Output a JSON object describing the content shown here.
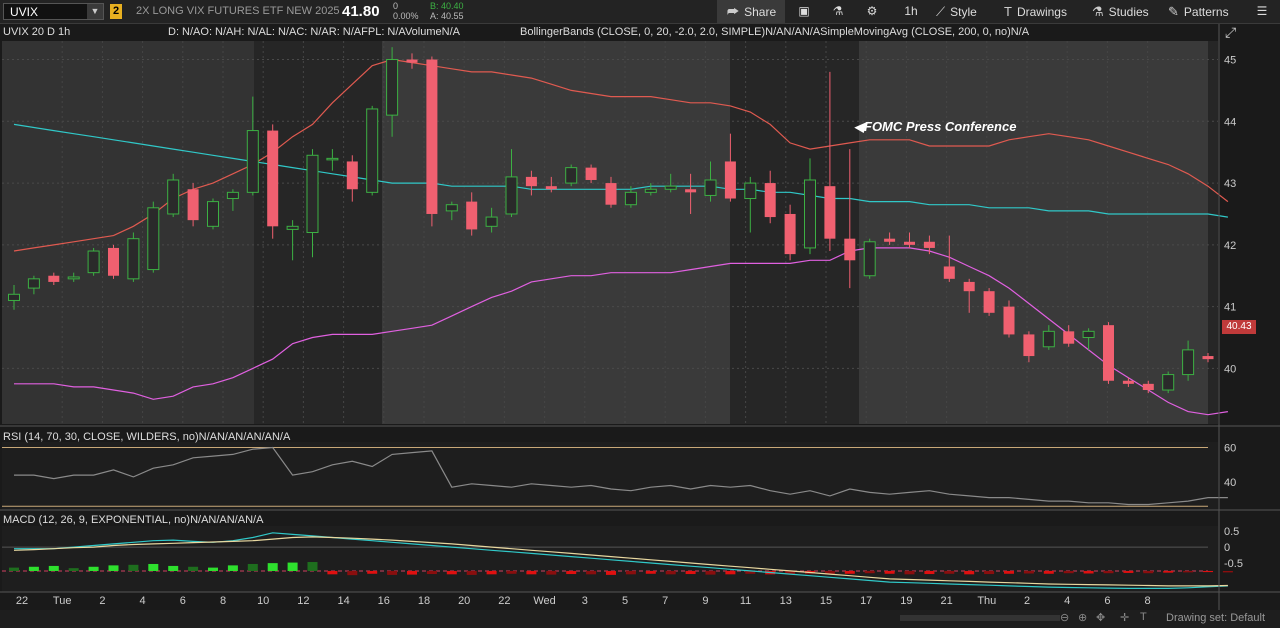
{
  "header": {
    "symbol": "UVIX",
    "badge": "2",
    "description": "2X LONG VIX FUTURES ETF NEW 2025",
    "last_price": "41.80",
    "change": "0",
    "change_pct": "0.00%",
    "bid": "B: 40.40",
    "ask": "A: 40.55"
  },
  "toolbar": {
    "share": "Share",
    "interval": "1h",
    "style": "Style",
    "drawings": "Drawings",
    "studies": "Studies",
    "patterns": "Patterns"
  },
  "legend": {
    "main_title": "UVIX 20 D 1h",
    "main_stats": "D: N/AO: N/AH: N/AL: N/AC: N/AR: N/AFPL: N/AVolumeN/A",
    "studies": "BollingerBands (CLOSE, 0, 20, -2.0, 2.0, SIMPLE)N/AN/AN/ASimpleMovingAvg (CLOSE, 200, 0, no)N/A",
    "rsi": "RSI (14, 70, 30, CLOSE, WILDERS, no)N/AN/AN/AN/AN/A",
    "macd": "MACD (12, 26, 9, EXPONENTIAL, no)N/AN/AN/AN/A"
  },
  "annotation": "FOMC Press Conference",
  "current_price_tag": "40.43",
  "price_axis": [
    "45",
    "44",
    "43",
    "42",
    "41",
    "40"
  ],
  "rsi_axis": [
    "60",
    "40"
  ],
  "macd_axis": [
    "0.5",
    "0",
    "-0.5"
  ],
  "time_axis": [
    "22",
    "Tue",
    "2",
    "4",
    "6",
    "8",
    "10",
    "12",
    "14",
    "16",
    "18",
    "20",
    "22",
    "Wed",
    "3",
    "5",
    "7",
    "9",
    "11",
    "13",
    "15",
    "17",
    "19",
    "21",
    "Thu",
    "2",
    "4",
    "6",
    "8"
  ],
  "bottom": {
    "drawing_set": "Drawing set: Default"
  },
  "colors": {
    "up": "#3cb043",
    "down": "#f06070",
    "upper_band": "#e05a50",
    "lower_band": "#e060e0",
    "sma": "#30c8c8",
    "macd_line": "#30c8c8",
    "signal": "#e8d8a0"
  },
  "chart_data": {
    "type": "candlestick",
    "interval": "1h",
    "y_range": [
      39.1,
      45.3
    ],
    "candles": [
      {
        "o": 41.1,
        "h": 41.35,
        "l": 40.95,
        "c": 41.2
      },
      {
        "o": 41.3,
        "h": 41.5,
        "l": 41.2,
        "c": 41.45
      },
      {
        "o": 41.5,
        "h": 41.55,
        "l": 41.35,
        "c": 41.4
      },
      {
        "o": 41.45,
        "h": 41.55,
        "l": 41.4,
        "c": 41.48
      },
      {
        "o": 41.55,
        "h": 41.95,
        "l": 41.5,
        "c": 41.9
      },
      {
        "o": 41.95,
        "h": 42.0,
        "l": 41.45,
        "c": 41.5
      },
      {
        "o": 41.45,
        "h": 42.2,
        "l": 41.4,
        "c": 42.1
      },
      {
        "o": 41.6,
        "h": 42.7,
        "l": 41.55,
        "c": 42.6
      },
      {
        "o": 42.5,
        "h": 43.15,
        "l": 42.45,
        "c": 43.05
      },
      {
        "o": 42.9,
        "h": 43.0,
        "l": 42.3,
        "c": 42.4
      },
      {
        "o": 42.3,
        "h": 42.75,
        "l": 42.25,
        "c": 42.7
      },
      {
        "o": 42.75,
        "h": 42.9,
        "l": 42.55,
        "c": 42.85
      },
      {
        "o": 42.85,
        "h": 44.4,
        "l": 42.8,
        "c": 43.85
      },
      {
        "o": 43.85,
        "h": 43.95,
        "l": 42.1,
        "c": 42.3
      },
      {
        "o": 42.25,
        "h": 42.4,
        "l": 41.75,
        "c": 42.3
      },
      {
        "o": 42.2,
        "h": 43.55,
        "l": 41.8,
        "c": 43.45
      },
      {
        "o": 43.4,
        "h": 43.55,
        "l": 43.2,
        "c": 43.4
      },
      {
        "o": 43.35,
        "h": 43.45,
        "l": 42.7,
        "c": 42.9
      },
      {
        "o": 42.85,
        "h": 44.25,
        "l": 42.8,
        "c": 44.2
      },
      {
        "o": 44.1,
        "h": 45.2,
        "l": 43.75,
        "c": 45.0
      },
      {
        "o": 45.0,
        "h": 45.1,
        "l": 44.85,
        "c": 44.95
      },
      {
        "o": 45.0,
        "h": 45.05,
        "l": 42.3,
        "c": 42.5
      },
      {
        "o": 42.55,
        "h": 42.7,
        "l": 42.4,
        "c": 42.65
      },
      {
        "o": 42.7,
        "h": 42.85,
        "l": 42.15,
        "c": 42.25
      },
      {
        "o": 42.3,
        "h": 42.6,
        "l": 42.2,
        "c": 42.45
      },
      {
        "o": 42.5,
        "h": 43.55,
        "l": 42.45,
        "c": 43.1
      },
      {
        "o": 43.1,
        "h": 43.2,
        "l": 42.8,
        "c": 42.95
      },
      {
        "o": 42.95,
        "h": 43.1,
        "l": 42.85,
        "c": 42.9
      },
      {
        "o": 43.0,
        "h": 43.3,
        "l": 42.95,
        "c": 43.25
      },
      {
        "o": 43.25,
        "h": 43.3,
        "l": 43.0,
        "c": 43.05
      },
      {
        "o": 43.0,
        "h": 43.1,
        "l": 42.6,
        "c": 42.65
      },
      {
        "o": 42.65,
        "h": 42.95,
        "l": 42.6,
        "c": 42.85
      },
      {
        "o": 42.85,
        "h": 43.0,
        "l": 42.8,
        "c": 42.9
      },
      {
        "o": 42.9,
        "h": 43.15,
        "l": 42.85,
        "c": 42.95
      },
      {
        "o": 42.9,
        "h": 43.15,
        "l": 42.5,
        "c": 42.85
      },
      {
        "o": 42.8,
        "h": 43.35,
        "l": 42.7,
        "c": 43.05
      },
      {
        "o": 43.35,
        "h": 43.8,
        "l": 42.7,
        "c": 42.75
      },
      {
        "o": 42.75,
        "h": 43.1,
        "l": 42.2,
        "c": 43.0
      },
      {
        "o": 43.0,
        "h": 43.2,
        "l": 42.35,
        "c": 42.45
      },
      {
        "o": 42.5,
        "h": 42.65,
        "l": 41.75,
        "c": 41.85
      },
      {
        "o": 41.95,
        "h": 43.4,
        "l": 41.85,
        "c": 43.05
      },
      {
        "o": 42.95,
        "h": 44.8,
        "l": 41.9,
        "c": 42.1
      },
      {
        "o": 42.1,
        "h": 43.55,
        "l": 41.3,
        "c": 41.75
      },
      {
        "o": 41.5,
        "h": 42.1,
        "l": 41.45,
        "c": 42.05
      },
      {
        "o": 42.1,
        "h": 42.2,
        "l": 42.0,
        "c": 42.05
      },
      {
        "o": 42.05,
        "h": 42.2,
        "l": 41.95,
        "c": 42.0
      },
      {
        "o": 42.05,
        "h": 42.15,
        "l": 41.85,
        "c": 41.95
      },
      {
        "o": 41.65,
        "h": 42.15,
        "l": 41.4,
        "c": 41.45
      },
      {
        "o": 41.4,
        "h": 41.45,
        "l": 40.9,
        "c": 41.25
      },
      {
        "o": 41.25,
        "h": 41.3,
        "l": 40.85,
        "c": 40.9
      },
      {
        "o": 41.0,
        "h": 41.1,
        "l": 40.5,
        "c": 40.55
      },
      {
        "o": 40.55,
        "h": 40.6,
        "l": 40.1,
        "c": 40.2
      },
      {
        "o": 40.35,
        "h": 40.7,
        "l": 40.3,
        "c": 40.6
      },
      {
        "o": 40.6,
        "h": 40.7,
        "l": 40.35,
        "c": 40.4
      },
      {
        "o": 40.5,
        "h": 40.65,
        "l": 40.3,
        "c": 40.6
      },
      {
        "o": 40.7,
        "h": 40.75,
        "l": 39.75,
        "c": 39.8
      },
      {
        "o": 39.8,
        "h": 39.85,
        "l": 39.7,
        "c": 39.75
      },
      {
        "o": 39.75,
        "h": 39.8,
        "l": 39.6,
        "c": 39.65
      },
      {
        "o": 39.65,
        "h": 39.95,
        "l": 39.6,
        "c": 39.9
      },
      {
        "o": 39.9,
        "h": 40.45,
        "l": 39.8,
        "c": 40.3
      },
      {
        "o": 40.2,
        "h": 40.25,
        "l": 40.1,
        "c": 40.15
      }
    ],
    "upper_band": [
      41.9,
      41.95,
      42.0,
      42.05,
      42.1,
      42.15,
      42.3,
      42.5,
      42.75,
      42.9,
      43.0,
      43.15,
      43.3,
      43.5,
      43.75,
      43.95,
      44.3,
      44.6,
      44.9,
      45.0,
      44.95,
      44.9,
      44.85,
      44.8,
      44.8,
      44.75,
      44.7,
      44.6,
      44.5,
      44.45,
      44.4,
      44.4,
      44.4,
      44.35,
      44.3,
      44.3,
      44.25,
      44.15,
      43.95,
      43.65,
      43.55,
      43.6,
      43.65,
      43.7,
      43.7,
      43.7,
      43.6,
      43.6,
      43.6,
      43.6,
      43.7,
      43.75,
      43.8,
      43.75,
      43.7,
      43.6,
      43.5,
      43.4,
      43.3,
      43.15,
      42.95,
      42.7
    ],
    "lower_band": [
      39.75,
      39.75,
      39.75,
      39.7,
      39.7,
      39.65,
      39.6,
      39.5,
      39.55,
      39.7,
      39.75,
      39.85,
      40.0,
      40.15,
      40.4,
      40.5,
      40.55,
      40.55,
      40.55,
      40.6,
      40.65,
      40.7,
      40.85,
      41.0,
      41.15,
      41.25,
      41.4,
      41.45,
      41.5,
      41.5,
      41.55,
      41.55,
      41.55,
      41.55,
      41.6,
      41.65,
      41.7,
      41.7,
      41.7,
      41.7,
      41.75,
      41.75,
      41.9,
      41.95,
      41.95,
      41.95,
      41.9,
      41.8,
      41.65,
      41.5,
      41.3,
      41.05,
      40.8,
      40.55,
      40.3,
      40.05,
      39.85,
      39.65,
      39.45,
      39.3,
      39.25,
      39.3
    ],
    "sma": [
      43.95,
      43.9,
      43.85,
      43.8,
      43.75,
      43.7,
      43.65,
      43.6,
      43.55,
      43.5,
      43.45,
      43.4,
      43.35,
      43.3,
      43.25,
      43.2,
      43.15,
      43.1,
      43.05,
      43.0,
      43.0,
      43.0,
      42.95,
      42.95,
      42.95,
      42.95,
      42.9,
      42.9,
      42.9,
      42.9,
      42.9,
      42.9,
      42.95,
      42.95,
      42.95,
      42.95,
      42.9,
      42.9,
      42.85,
      42.85,
      42.8,
      42.75,
      42.75,
      42.7,
      42.7,
      42.7,
      42.65,
      42.65,
      42.65,
      42.6,
      42.6,
      42.6,
      42.55,
      42.55,
      42.55,
      42.5,
      42.5,
      42.5,
      42.5,
      42.5,
      42.5,
      42.45
    ],
    "rsi": [
      44,
      44,
      42,
      44,
      44,
      47,
      43,
      48,
      50,
      54,
      55,
      56,
      59,
      60,
      44,
      46,
      50,
      52,
      49,
      56,
      57,
      58,
      37,
      39,
      38,
      37,
      39,
      38,
      37,
      38,
      36,
      35,
      37,
      38,
      36,
      38,
      37,
      38,
      35,
      33,
      35,
      32,
      36,
      34,
      33,
      34,
      35,
      33,
      32,
      31,
      31,
      30,
      29,
      29,
      28,
      28,
      27,
      27,
      28,
      29,
      31,
      31
    ],
    "macd_hist": [
      0.12,
      0.15,
      0.18,
      0.1,
      0.15,
      0.2,
      0.22,
      0.25,
      0.18,
      0.15,
      0.12,
      0.2,
      0.25,
      0.28,
      0.3,
      0.32,
      -0.12,
      -0.15,
      -0.1,
      -0.14,
      -0.13,
      -0.11,
      -0.12,
      -0.14,
      -0.12,
      -0.1,
      -0.12,
      -0.13,
      -0.11,
      -0.12,
      -0.14,
      -0.12,
      -0.1,
      -0.12,
      -0.11,
      -0.13,
      -0.12,
      -0.1,
      -0.12,
      -0.11,
      -0.09,
      -0.12,
      -0.1,
      -0.08,
      -0.1,
      -0.12,
      -0.11,
      -0.1,
      -0.12,
      -0.11,
      -0.1,
      -0.09,
      -0.1,
      -0.08,
      -0.09,
      -0.08,
      -0.07,
      -0.08,
      -0.06,
      -0.05,
      -0.04,
      -0.05
    ],
    "macd_line": [
      -0.05,
      -0.05,
      -0.05,
      0.0,
      0.05,
      0.1,
      0.15,
      0.2,
      0.22,
      0.18,
      0.15,
      0.2,
      0.3,
      0.45,
      0.4,
      0.35,
      0.3,
      0.25,
      0.2,
      0.15,
      0.1,
      0.05,
      0.0,
      -0.05,
      -0.1,
      -0.15,
      -0.2,
      -0.25,
      -0.3,
      -0.35,
      -0.4,
      -0.45,
      -0.5,
      -0.55,
      -0.6,
      -0.65,
      -0.7,
      -0.75,
      -0.8,
      -0.85,
      -0.9,
      -0.95,
      -1.0,
      -1.05,
      -1.1,
      -1.12,
      -1.14,
      -1.16,
      -1.18,
      -1.2,
      -1.22,
      -1.24,
      -1.26,
      -1.27,
      -1.28,
      -1.29,
      -1.3,
      -1.3,
      -1.3,
      -1.28,
      -1.25,
      -1.22
    ],
    "signal_line": [
      -0.1,
      -0.08,
      -0.05,
      -0.02,
      0.0,
      0.05,
      0.08,
      0.1,
      0.12,
      0.14,
      0.16,
      0.18,
      0.2,
      0.25,
      0.3,
      0.32,
      0.3,
      0.28,
      0.25,
      0.22,
      0.18,
      0.14,
      0.1,
      0.05,
      0.0,
      -0.05,
      -0.1,
      -0.15,
      -0.2,
      -0.25,
      -0.3,
      -0.35,
      -0.4,
      -0.45,
      -0.5,
      -0.55,
      -0.6,
      -0.65,
      -0.7,
      -0.75,
      -0.8,
      -0.85,
      -0.9,
      -0.95,
      -1.0,
      -1.02,
      -1.04,
      -1.06,
      -1.08,
      -1.1,
      -1.12,
      -1.14,
      -1.16,
      -1.17,
      -1.18,
      -1.19,
      -1.2,
      -1.21,
      -1.22,
      -1.22,
      -1.22,
      -1.21
    ],
    "rsi_range": [
      25,
      62
    ],
    "macd_range": [
      -1.35,
      0.6
    ]
  }
}
